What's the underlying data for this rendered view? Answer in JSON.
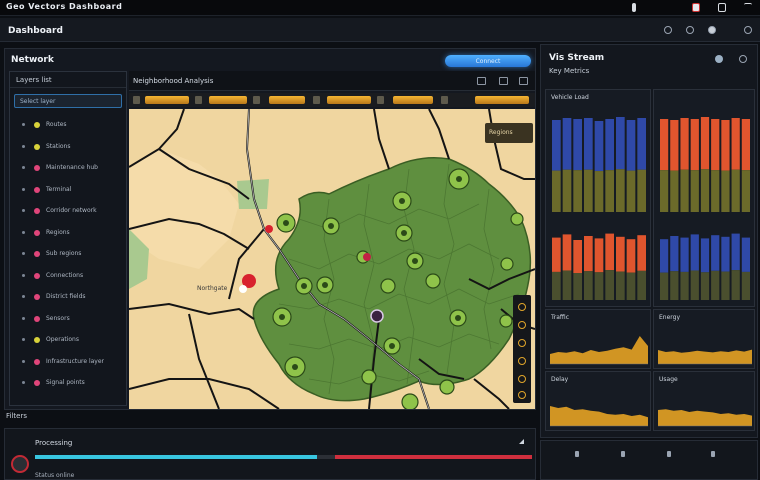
{
  "window": {
    "title": "Geo Vectors Dashboard"
  },
  "header": {
    "title": "Dashboard"
  },
  "left_panel": {
    "title": "Network",
    "connect_button": "Connect",
    "sidebar": {
      "header": "Layers list",
      "search": "Select layer",
      "items": [
        {
          "label": "Routes",
          "color": "#d8d23a"
        },
        {
          "label": "Stations",
          "color": "#d8d23a"
        },
        {
          "label": "Maintenance hub",
          "color": "#e0457a"
        },
        {
          "label": "Terminal",
          "color": "#e0457a"
        },
        {
          "label": "Corridor network",
          "color": "#e0457a"
        },
        {
          "label": "Regions",
          "color": "#e0457a"
        },
        {
          "label": "Sub regions",
          "color": "#e0457a"
        },
        {
          "label": "Connections",
          "color": "#e0457a"
        },
        {
          "label": "District fields",
          "color": "#e0457a"
        },
        {
          "label": "Sensors",
          "color": "#e0457a"
        },
        {
          "label": "Operations",
          "color": "#d8d23a"
        },
        {
          "label": "Infrastructure layer",
          "color": "#e0457a"
        },
        {
          "label": "Signal points",
          "color": "#e0457a"
        }
      ]
    },
    "footer": "Filters"
  },
  "map": {
    "toolbar_title": "Neighborhood Analysis",
    "legend": "Regions",
    "place_label": "Northgate"
  },
  "bottom": {
    "label": "Processing",
    "sub": "Status online",
    "progress_a": 0.57,
    "progress_b": 0.4
  },
  "right_panel": {
    "title": "Vis Stream",
    "subtitle": "Key Metrics",
    "cell1_title": "Vehicle Load",
    "cell5_title": "Traffic",
    "cell6_title": "Energy",
    "cell7_title": "Delay",
    "cell8_title": "Usage"
  },
  "chart_data": [
    {
      "type": "bar",
      "series": [
        {
          "values": [
            0.92,
            0.94,
            0.93,
            0.94,
            0.91,
            0.93,
            0.95,
            0.92,
            0.94
          ]
        }
      ],
      "colors": [
        "#2f49a8",
        "#6b6a2a"
      ]
    },
    {
      "type": "bar",
      "series": [
        {
          "values": [
            0.93,
            0.92,
            0.94,
            0.93,
            0.95,
            0.93,
            0.92,
            0.94,
            0.93
          ]
        }
      ],
      "colors": [
        "#e0552e",
        "#6b6a2a"
      ]
    },
    {
      "type": "bar",
      "series": [
        {
          "values": [
            0.78,
            0.82,
            0.75,
            0.8,
            0.77,
            0.83,
            0.79,
            0.76,
            0.81
          ]
        }
      ],
      "colors": [
        "#e0552e",
        "#4a4f2e"
      ]
    },
    {
      "type": "bar",
      "series": [
        {
          "values": [
            0.76,
            0.8,
            0.78,
            0.82,
            0.77,
            0.81,
            0.79,
            0.83,
            0.78
          ]
        }
      ],
      "colors": [
        "#2f49a8",
        "#4a4f2e"
      ]
    },
    {
      "type": "area",
      "values": [
        0.25,
        0.3,
        0.28,
        0.32,
        0.27,
        0.35,
        0.3,
        0.33,
        0.38,
        0.42,
        0.36,
        0.7,
        0.45
      ],
      "color": "#e6a324"
    },
    {
      "type": "area",
      "values": [
        0.35,
        0.3,
        0.32,
        0.28,
        0.3,
        0.33,
        0.31,
        0.29,
        0.32,
        0.3,
        0.34,
        0.31,
        0.36
      ],
      "color": "#e6a324"
    },
    {
      "type": "area",
      "values": [
        0.5,
        0.45,
        0.48,
        0.4,
        0.42,
        0.38,
        0.36,
        0.3,
        0.28,
        0.3,
        0.25,
        0.28,
        0.22
      ],
      "color": "#e6a324"
    },
    {
      "type": "area",
      "values": [
        0.4,
        0.42,
        0.38,
        0.4,
        0.35,
        0.38,
        0.36,
        0.34,
        0.3,
        0.32,
        0.28,
        0.3,
        0.26
      ],
      "color": "#e6a324"
    }
  ]
}
